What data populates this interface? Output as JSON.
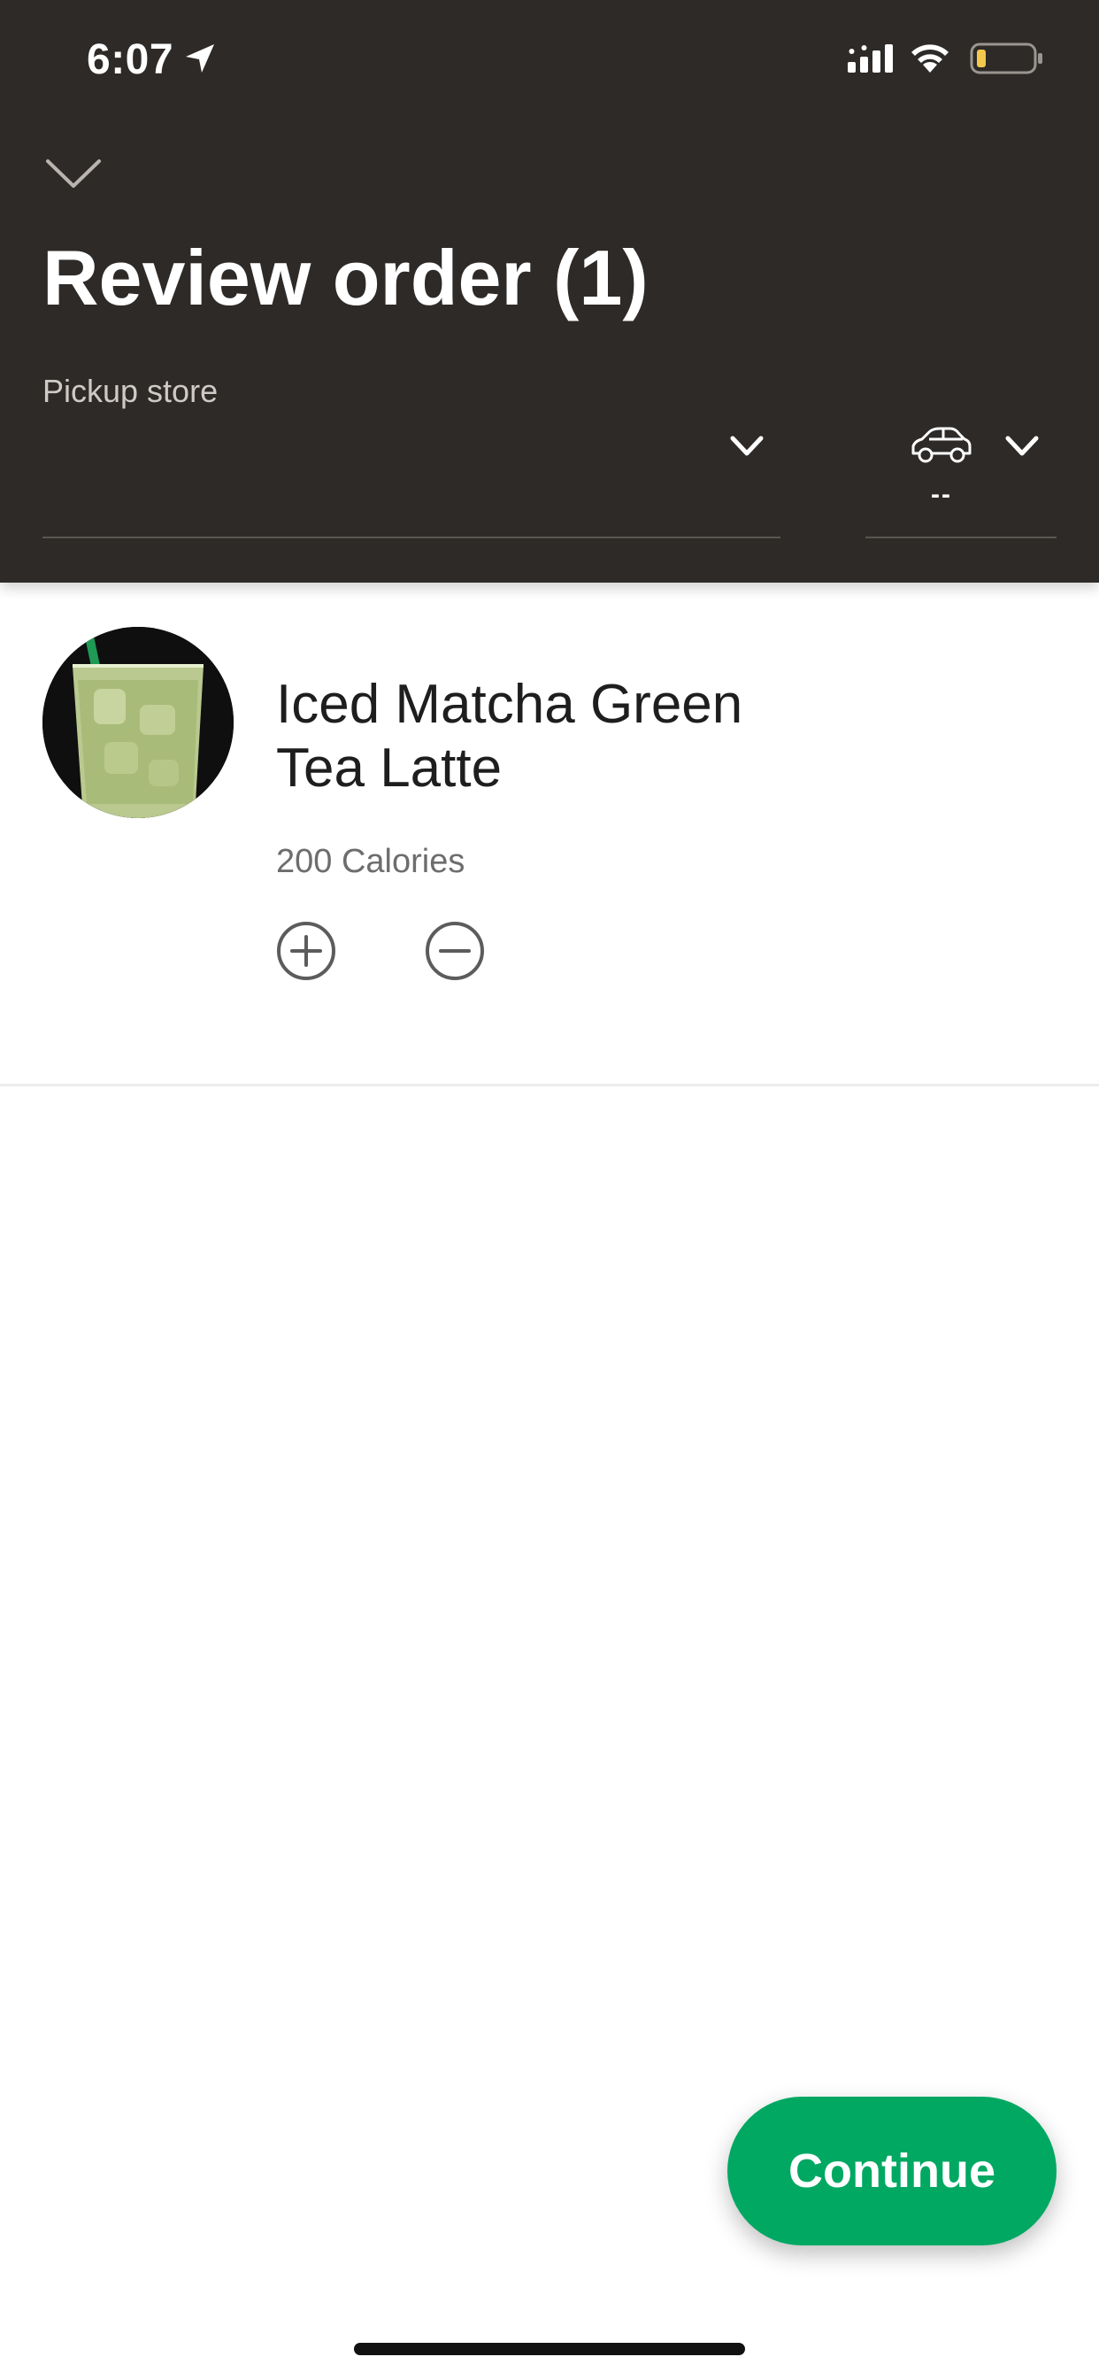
{
  "status_bar": {
    "time": "6:07",
    "icons": [
      "location-arrow-icon",
      "cellular-signal-icon",
      "wifi-icon",
      "battery-low-icon"
    ],
    "battery_color": "#f2c94c"
  },
  "header": {
    "title": "Review order (1)",
    "collapse_icon": "chevron-down-icon",
    "pickup_label": "Pickup store",
    "store_value": "",
    "mode_icon": "car-icon",
    "mode_value": "--",
    "background_color": "#2d2a28"
  },
  "order": {
    "items": [
      {
        "name": "Iced Matcha Green Tea Latte",
        "calories": "200 Calories",
        "image": "iced-matcha-latte-photo",
        "add_icon": "plus-circle-icon",
        "remove_icon": "minus-circle-icon"
      }
    ]
  },
  "actions": {
    "continue_label": "Continue",
    "accent_color": "#00a862"
  }
}
